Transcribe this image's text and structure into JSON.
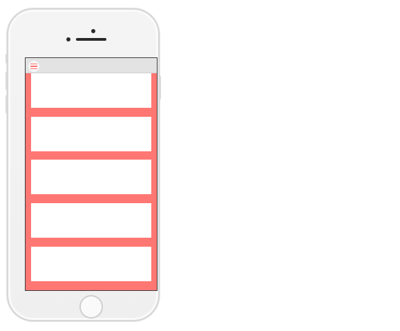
{
  "device": {
    "type": "smartphone",
    "color": "#f2f2f2"
  },
  "app": {
    "topbar": {
      "menu_icon": "hamburger-menu-icon",
      "background": "#e3e3e3"
    },
    "background_color": "#ff7773",
    "cards": [
      {
        "content": ""
      },
      {
        "content": ""
      },
      {
        "content": ""
      },
      {
        "content": ""
      },
      {
        "content": ""
      }
    ]
  }
}
